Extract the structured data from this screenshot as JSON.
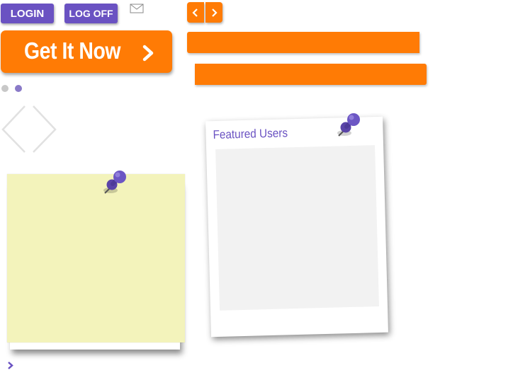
{
  "header": {
    "login_label": "LOGIN",
    "logoff_label": "LOG OFF",
    "mail_icon": "mail-icon"
  },
  "slider_nav": {
    "prev_icon": "chevron-left-icon",
    "next_icon": "chevron-right-icon"
  },
  "cta": {
    "label": "Get It Now",
    "icon": "chevron-right-icon"
  },
  "pagination": {
    "dots": [
      {
        "state": "inactive",
        "color": "#c8c8c8"
      },
      {
        "state": "active",
        "color": "#8a7ac8"
      }
    ]
  },
  "featured": {
    "title": "Featured Users"
  },
  "colors": {
    "purple": "#6a52c2",
    "orange": "#ff7b05",
    "sticky_note": "#f3f3bb",
    "photo_placeholder": "#f2f2f2"
  },
  "footer": {
    "more_icon": "chevron-right-icon"
  }
}
